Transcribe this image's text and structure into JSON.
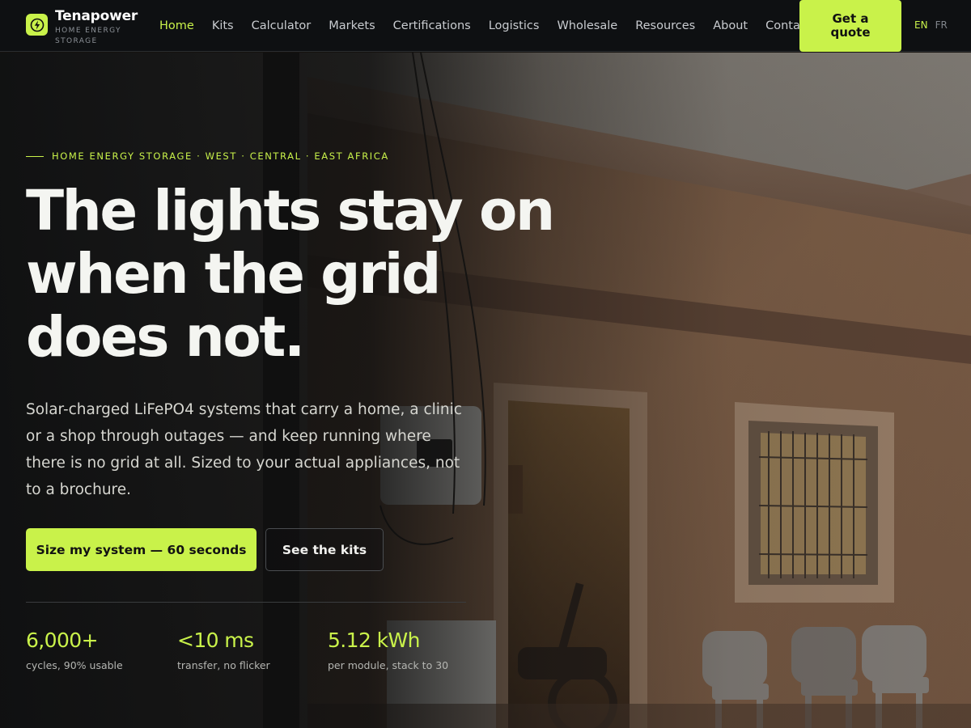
{
  "brand": {
    "name": "Tenapower",
    "tagline": "HOME ENERGY STORAGE"
  },
  "nav": {
    "items": [
      {
        "label": "Home",
        "active": true
      },
      {
        "label": "Kits",
        "active": false
      },
      {
        "label": "Calculator",
        "active": false
      },
      {
        "label": "Markets",
        "active": false
      },
      {
        "label": "Certifications",
        "active": false
      },
      {
        "label": "Logistics",
        "active": false
      },
      {
        "label": "Wholesale",
        "active": false
      },
      {
        "label": "Resources",
        "active": false
      },
      {
        "label": "About",
        "active": false
      },
      {
        "label": "Contact",
        "active": false
      }
    ],
    "cta_label": "Get a quote",
    "languages": [
      {
        "code": "EN",
        "active": true
      },
      {
        "code": "FR",
        "active": false
      }
    ]
  },
  "hero": {
    "eyebrow": "HOME ENERGY STORAGE · WEST · CENTRAL · EAST AFRICA",
    "headline_lines": [
      "The lights stay on",
      "when the grid",
      "does not."
    ],
    "lede": "Solar-charged LiFePO4 systems that carry a home, a clinic or a shop through outages — and keep running where there is no grid at all. Sized to your actual appliances, not to a brochure.",
    "primary_button": "Size my system — 60 seconds",
    "secondary_button": "See the kits",
    "stats": [
      {
        "value": "6,000+",
        "label": "cycles, 90% usable"
      },
      {
        "value": "<10 ms",
        "label": "transfer, no flicker"
      },
      {
        "value": "5.12 kWh",
        "label": "per module, stack to 30"
      }
    ]
  },
  "colors": {
    "accent": "#c9f24a",
    "header_bg": "#0e1012",
    "text_light": "#f4f5f1"
  }
}
